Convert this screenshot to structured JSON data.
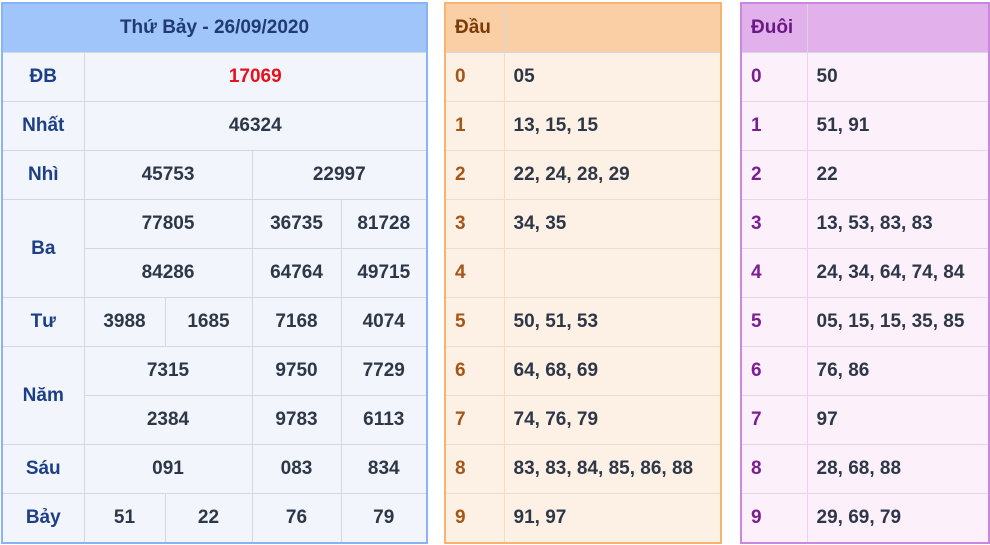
{
  "results": {
    "title": "Thứ Bảy - 26/09/2020",
    "rows": [
      {
        "label": "ĐB",
        "values": [
          "17069"
        ]
      },
      {
        "label": "Nhất",
        "values": [
          "46324"
        ]
      },
      {
        "label": "Nhì",
        "values": [
          "45753",
          "22997"
        ]
      },
      {
        "label": "Ba",
        "values": [
          "77805",
          "36735",
          "81728",
          "84286",
          "64764",
          "49715"
        ]
      },
      {
        "label": "Tư",
        "values": [
          "3988",
          "1685",
          "7168",
          "4074"
        ]
      },
      {
        "label": "Năm",
        "values": [
          "7315",
          "9750",
          "7729",
          "2384",
          "9783",
          "6113"
        ]
      },
      {
        "label": "Sáu",
        "values": [
          "091",
          "083",
          "834"
        ]
      },
      {
        "label": "Bảy",
        "values": [
          "51",
          "22",
          "76",
          "79"
        ]
      }
    ]
  },
  "dau": {
    "header": "Đầu",
    "rows": [
      {
        "key": "0",
        "values": "05"
      },
      {
        "key": "1",
        "values": "13, 15, 15"
      },
      {
        "key": "2",
        "values": "22, 24, 28, 29"
      },
      {
        "key": "3",
        "values": "34, 35"
      },
      {
        "key": "4",
        "values": ""
      },
      {
        "key": "5",
        "values": "50, 51, 53"
      },
      {
        "key": "6",
        "values": "64, 68, 69"
      },
      {
        "key": "7",
        "values": "74, 76, 79"
      },
      {
        "key": "8",
        "values": "83, 83, 84, 85, 86, 88"
      },
      {
        "key": "9",
        "values": "91, 97"
      }
    ]
  },
  "duoi": {
    "header": "Đuôi",
    "rows": [
      {
        "key": "0",
        "values": "50"
      },
      {
        "key": "1",
        "values": "51, 91"
      },
      {
        "key": "2",
        "values": "22"
      },
      {
        "key": "3",
        "values": "13, 53, 83, 83"
      },
      {
        "key": "4",
        "values": "24, 34, 64, 74, 84"
      },
      {
        "key": "5",
        "values": "05, 15, 15, 35, 85"
      },
      {
        "key": "6",
        "values": "76, 86"
      },
      {
        "key": "7",
        "values": "97"
      },
      {
        "key": "8",
        "values": "28, 68, 88"
      },
      {
        "key": "9",
        "values": "29, 69, 79"
      }
    ]
  },
  "colors": {
    "special_prize": "#e8101a",
    "results_accent": "#9fc5fb",
    "dau_accent": "#fbcfa5",
    "duoi_accent": "#e2b1ec"
  }
}
